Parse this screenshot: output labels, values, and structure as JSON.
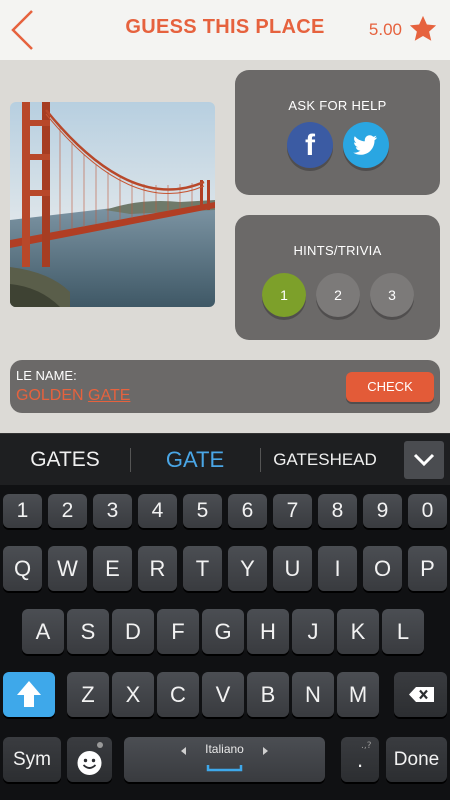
{
  "header": {
    "title": "GUESS THIS PLACE",
    "score": "5.00"
  },
  "help": {
    "label": "ASK FOR HELP",
    "facebook": "f"
  },
  "hints": {
    "label": "HINTS/TRIVIA",
    "items": [
      "1",
      "2",
      "3"
    ]
  },
  "answer": {
    "label": "LE NAME:",
    "value_first": "GOLDEN ",
    "value_underlined": "GATE",
    "check_label": "CHECK"
  },
  "suggestions": [
    "GATES",
    "GATE",
    "GATESHEAD"
  ],
  "keyboard": {
    "numbers": [
      "1",
      "2",
      "3",
      "4",
      "5",
      "6",
      "7",
      "8",
      "9",
      "0"
    ],
    "row1": [
      "Q",
      "W",
      "E",
      "R",
      "T",
      "Y",
      "U",
      "I",
      "O",
      "P"
    ],
    "row2": [
      "A",
      "S",
      "D",
      "F",
      "G",
      "H",
      "J",
      "K",
      "L"
    ],
    "row3": [
      "Z",
      "X",
      "C",
      "V",
      "B",
      "N",
      "M"
    ],
    "sym": "Sym",
    "language": "Italiano",
    "period": ".",
    "done": "Done"
  },
  "colors": {
    "accent": "#e6623e",
    "hint_active": "#7da02a",
    "suggestion_selected": "#4aa6e6"
  }
}
